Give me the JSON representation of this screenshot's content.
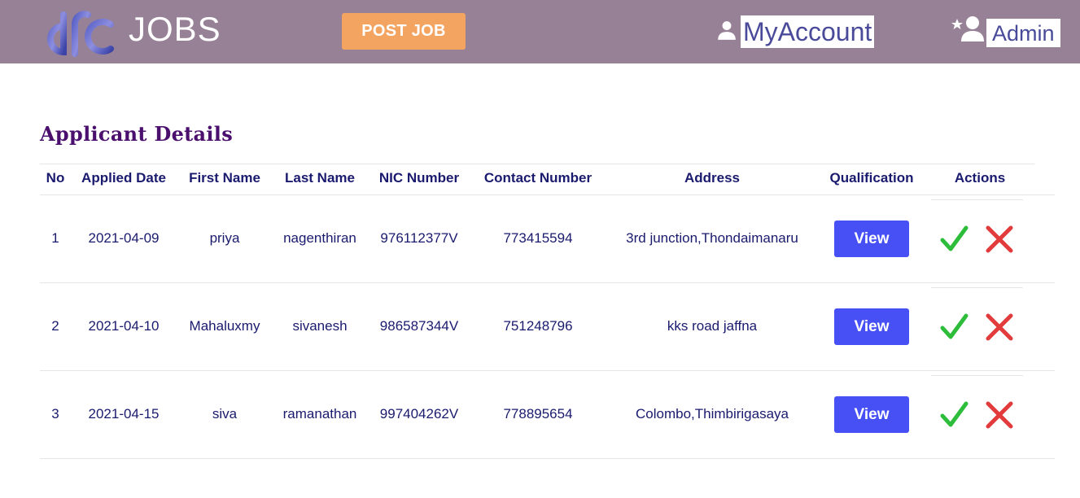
{
  "header": {
    "brand": "JOBS",
    "post_job_label": "POST JOB",
    "my_account_label": "MyAccount",
    "admin_label": "Admin",
    "colors": {
      "navbar": "#978196",
      "post_job": "#f4a461",
      "view_button": "#4650f4",
      "approve": "#2ebd3b",
      "reject": "#e23b3b",
      "title": "#4b0f6e"
    }
  },
  "page": {
    "title": "Applicant Details"
  },
  "table": {
    "columns": [
      "No",
      "Applied Date",
      "First Name",
      "Last Name",
      "NIC Number",
      "Contact Number",
      "Address",
      "Qualification",
      "Actions"
    ],
    "rows": [
      {
        "no": "1",
        "applied_date": "2021-04-09",
        "first_name": "priya",
        "last_name": "nagenthiran",
        "nic": "976112377V",
        "contact": "773415594",
        "address": "3rd junction,Thondaimanaru",
        "qualification_label": "View"
      },
      {
        "no": "2",
        "applied_date": "2021-04-10",
        "first_name": "Mahaluxmy",
        "last_name": "sivanesh",
        "nic": "986587344V",
        "contact": "751248796",
        "address": "kks road jaffna",
        "qualification_label": "View"
      },
      {
        "no": "3",
        "applied_date": "2021-04-15",
        "first_name": "siva",
        "last_name": "ramanathan",
        "nic": "997404262V",
        "contact": "778895654",
        "address": "Colombo,Thimbirigasaya",
        "qualification_label": "View"
      }
    ],
    "actions": {
      "approve_icon": "check-icon",
      "reject_icon": "cross-icon"
    }
  }
}
